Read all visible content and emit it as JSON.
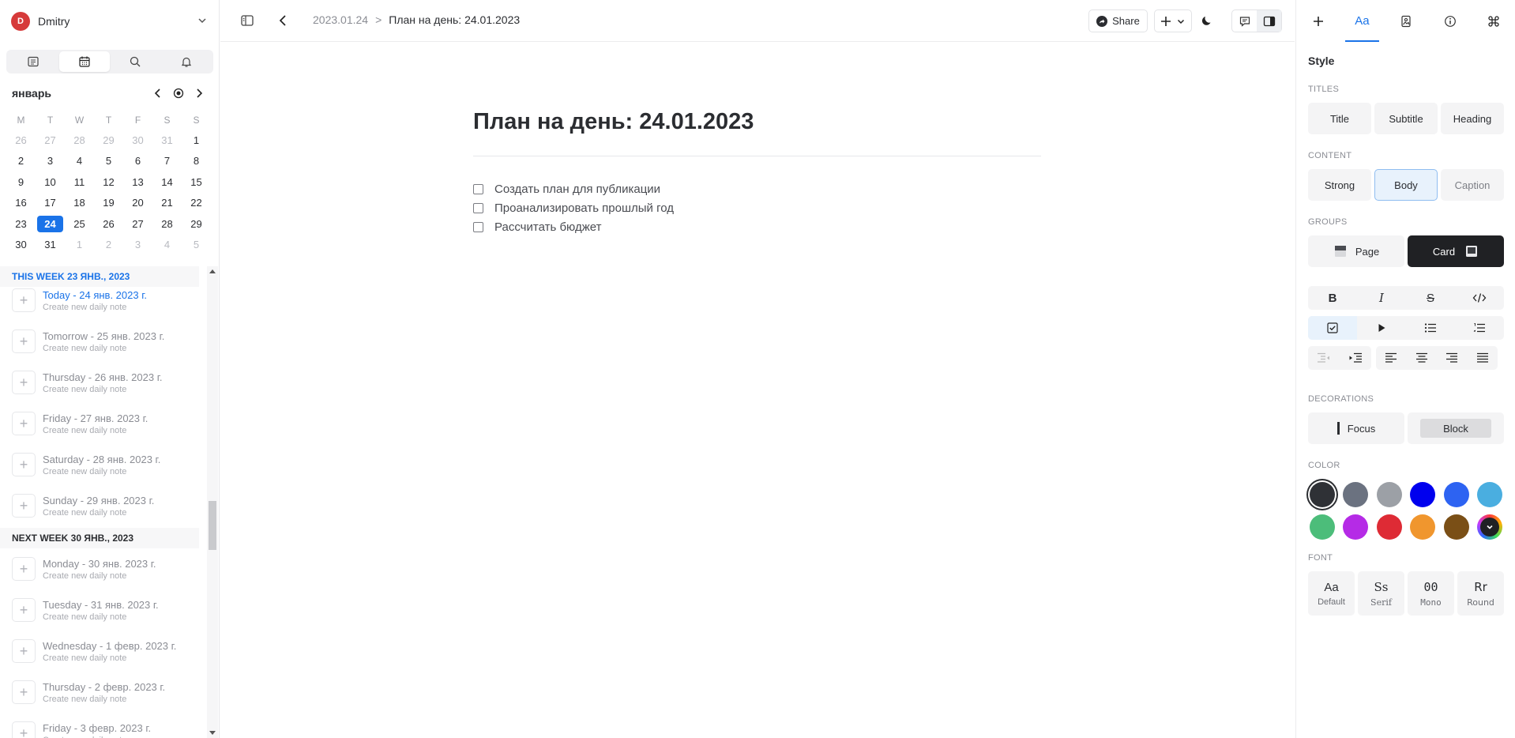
{
  "sidebar": {
    "user": {
      "initial": "D",
      "name": "Dmitry"
    },
    "tabs": [
      "notes-icon",
      "calendar-icon",
      "search-icon",
      "bell-icon"
    ],
    "calendar": {
      "month": "январь",
      "weekdays": [
        "M",
        "T",
        "W",
        "T",
        "F",
        "S",
        "S"
      ],
      "weeks": [
        [
          "26",
          "27",
          "28",
          "29",
          "30",
          "31",
          "1"
        ],
        [
          "2",
          "3",
          "4",
          "5",
          "6",
          "7",
          "8"
        ],
        [
          "9",
          "10",
          "11",
          "12",
          "13",
          "14",
          "15"
        ],
        [
          "16",
          "17",
          "18",
          "19",
          "20",
          "21",
          "22"
        ],
        [
          "23",
          "24",
          "25",
          "26",
          "27",
          "28",
          "29"
        ],
        [
          "30",
          "31",
          "1",
          "2",
          "3",
          "4",
          "5"
        ]
      ],
      "today": "24"
    },
    "this_week": {
      "header": "THIS WEEK 23 ЯНВ., 2023",
      "items": [
        {
          "title": "Today - 24 янв. 2023 г.",
          "sub": "Create new daily note"
        },
        {
          "title": "Tomorrow - 25 янв. 2023 г.",
          "sub": "Create new daily note"
        },
        {
          "title": "Thursday - 26 янв. 2023 г.",
          "sub": "Create new daily note"
        },
        {
          "title": "Friday - 27 янв. 2023 г.",
          "sub": "Create new daily note"
        },
        {
          "title": "Saturday - 28 янв. 2023 г.",
          "sub": "Create new daily note"
        },
        {
          "title": "Sunday - 29 янв. 2023 г.",
          "sub": "Create new daily note"
        }
      ]
    },
    "next_week": {
      "header": "NEXT WEEK 30 ЯНВ., 2023",
      "items": [
        {
          "title": "Monday - 30 янв. 2023 г.",
          "sub": "Create new daily note"
        },
        {
          "title": "Tuesday - 31 янв. 2023 г.",
          "sub": "Create new daily note"
        },
        {
          "title": "Wednesday - 1 февр. 2023 г.",
          "sub": "Create new daily note"
        },
        {
          "title": "Thursday - 2 февр. 2023 г.",
          "sub": "Create new daily note"
        },
        {
          "title": "Friday - 3 февр. 2023 г.",
          "sub": "Create new daily note"
        }
      ]
    }
  },
  "topbar": {
    "breadcrumb_parent": "2023.01.24",
    "breadcrumb_current": "План на день: 24.01.2023",
    "share_label": "Share"
  },
  "document": {
    "title_prefix": "План на день: ",
    "title_bold": "24.01.2023",
    "tasks": [
      "Создать план для публикации",
      "Проанализировать прошлый год",
      "Рассчитать бюджет"
    ]
  },
  "panel": {
    "tab_aa": "Aa",
    "style_title": "Style",
    "titles_label": "TITLES",
    "titles": [
      "Title",
      "Subtitle",
      "Heading"
    ],
    "content_label": "CONTENT",
    "content": [
      "Strong",
      "Body",
      "Caption"
    ],
    "groups_label": "GROUPS",
    "groups": [
      "Page",
      "Card"
    ],
    "decorations_label": "DECORATIONS",
    "decorations": [
      "Focus",
      "Block"
    ],
    "color_label": "COLOR",
    "colors": [
      "#2f3136",
      "#6b7280",
      "#9ca0a6",
      "#0000ee",
      "#2d63f2",
      "#4aaee0",
      "#4cbd7a",
      "#b52be6",
      "#de2b35",
      "#f0962e",
      "#7a4f16"
    ],
    "font_label": "FONT",
    "fonts": [
      {
        "glyph": "Aa",
        "name": "Default"
      },
      {
        "glyph": "Ss",
        "name": "Serif"
      },
      {
        "glyph": "00",
        "name": "Mono"
      },
      {
        "glyph": "Rr",
        "name": "Round"
      }
    ]
  }
}
